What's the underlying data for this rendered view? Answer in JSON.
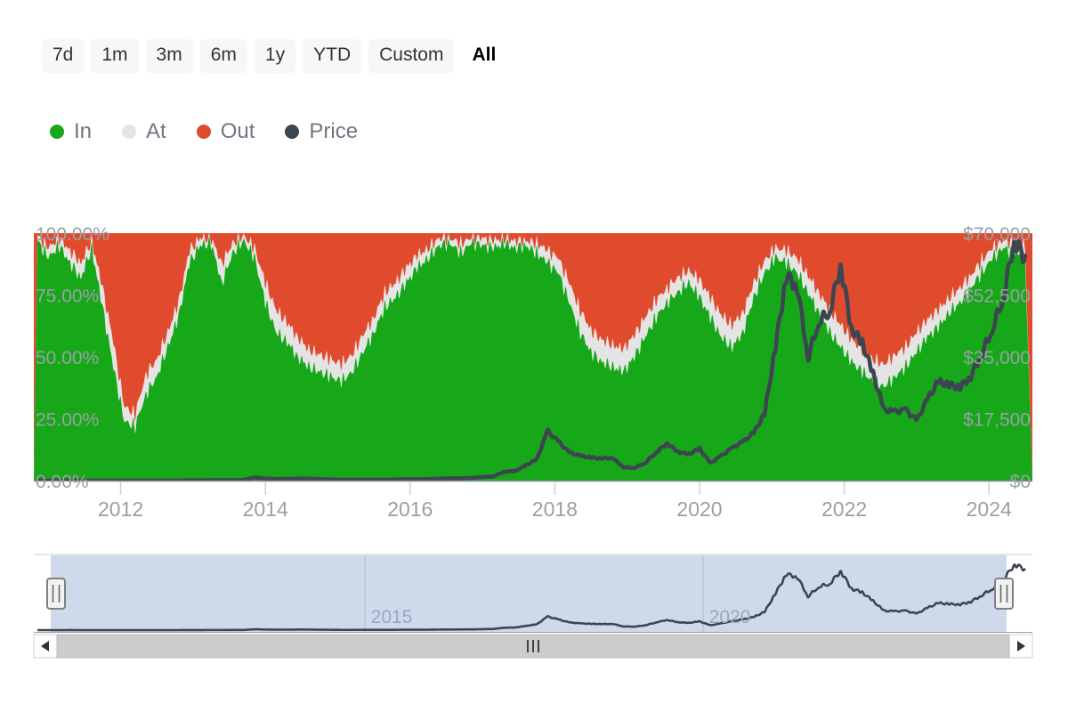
{
  "range_selector": {
    "buttons": [
      {
        "label": "7d",
        "selected": false
      },
      {
        "label": "1m",
        "selected": false
      },
      {
        "label": "3m",
        "selected": false
      },
      {
        "label": "6m",
        "selected": false
      },
      {
        "label": "1y",
        "selected": false
      },
      {
        "label": "YTD",
        "selected": false
      },
      {
        "label": "Custom",
        "selected": false
      },
      {
        "label": "All",
        "selected": true
      }
    ]
  },
  "legend": {
    "items": [
      {
        "label": "In",
        "color": "#17a81a"
      },
      {
        "label": "At",
        "color": "#e4e4e4"
      },
      {
        "label": "Out",
        "color": "#e04b2e"
      },
      {
        "label": "Price",
        "color": "#3d4550"
      }
    ]
  },
  "chart_data": {
    "type": "area",
    "title": "",
    "subtitle": "",
    "xlabel": "",
    "ylabel": "",
    "y2label": "",
    "grid": false,
    "legend_position": "top-left",
    "x_ticks": [
      "2012",
      "2014",
      "2016",
      "2018",
      "2020",
      "2022",
      "2024"
    ],
    "x_tick_values": [
      2012,
      2014,
      2016,
      2018,
      2020,
      2022,
      2024
    ],
    "xlim": [
      2010.8,
      2024.6
    ],
    "y_left_ticks": [
      "0.00%",
      "25.00%",
      "50.00%",
      "75.00%",
      "100.00%"
    ],
    "y_left_values": [
      0,
      25,
      50,
      75,
      100
    ],
    "ylim": [
      0,
      100
    ],
    "y_right_ticks": [
      "$0",
      "$17,500",
      "$35,000",
      "$52,500",
      "$70,000"
    ],
    "y_right_values": [
      0,
      17500,
      35000,
      52500,
      70000
    ],
    "y2lim": [
      0,
      70000
    ],
    "x": [
      2010.85,
      2011.0,
      2011.15,
      2011.3,
      2011.45,
      2011.6,
      2011.75,
      2011.9,
      2012.05,
      2012.2,
      2012.35,
      2012.5,
      2012.65,
      2012.8,
      2012.95,
      2013.1,
      2013.25,
      2013.4,
      2013.55,
      2013.7,
      2013.85,
      2014.0,
      2014.15,
      2014.3,
      2014.45,
      2014.6,
      2014.75,
      2014.9,
      2015.05,
      2015.2,
      2015.35,
      2015.5,
      2015.65,
      2015.8,
      2015.95,
      2016.1,
      2016.25,
      2016.4,
      2016.55,
      2016.7,
      2016.85,
      2017.0,
      2017.15,
      2017.3,
      2017.45,
      2017.6,
      2017.75,
      2017.9,
      2018.05,
      2018.2,
      2018.35,
      2018.5,
      2018.65,
      2018.8,
      2018.95,
      2019.1,
      2019.25,
      2019.4,
      2019.55,
      2019.7,
      2019.85,
      2020.0,
      2020.15,
      2020.3,
      2020.45,
      2020.6,
      2020.75,
      2020.9,
      2021.05,
      2021.2,
      2021.35,
      2021.5,
      2021.65,
      2021.8,
      2021.95,
      2022.1,
      2022.25,
      2022.4,
      2022.55,
      2022.7,
      2022.85,
      2023.0,
      2023.15,
      2023.3,
      2023.45,
      2023.6,
      2023.75,
      2023.9,
      2024.05,
      2024.2,
      2024.35,
      2024.5
    ],
    "series": [
      {
        "name": "In",
        "color": "#17a81a",
        "stack": "percent",
        "values": [
          97,
          90,
          95,
          88,
          82,
          94,
          70,
          46,
          24,
          22,
          35,
          42,
          54,
          66,
          88,
          95,
          96,
          80,
          92,
          97,
          90,
          72,
          60,
          56,
          50,
          46,
          44,
          42,
          40,
          44,
          52,
          60,
          70,
          74,
          80,
          86,
          90,
          95,
          96,
          92,
          96,
          95,
          94,
          96,
          94,
          95,
          92,
          88,
          84,
          72,
          60,
          52,
          48,
          46,
          44,
          50,
          58,
          66,
          72,
          76,
          80,
          74,
          66,
          58,
          54,
          60,
          74,
          84,
          90,
          88,
          84,
          76,
          68,
          60,
          54,
          48,
          44,
          40,
          38,
          42,
          46,
          52,
          58,
          62,
          68,
          72,
          78,
          84,
          90,
          94,
          92,
          90
        ]
      },
      {
        "name": "At",
        "color": "#e4e4e4",
        "stack": "percent",
        "values": [
          2,
          4,
          3,
          5,
          6,
          3,
          8,
          10,
          6,
          5,
          8,
          7,
          6,
          6,
          5,
          3,
          2,
          8,
          4,
          2,
          4,
          8,
          9,
          8,
          8,
          7,
          7,
          7,
          7,
          7,
          7,
          6,
          6,
          6,
          6,
          5,
          4,
          3,
          2,
          4,
          2,
          3,
          3,
          2,
          3,
          2,
          4,
          5,
          6,
          8,
          9,
          9,
          9,
          9,
          9,
          9,
          8,
          7,
          6,
          6,
          5,
          7,
          8,
          9,
          9,
          8,
          6,
          5,
          4,
          5,
          6,
          7,
          8,
          9,
          9,
          9,
          9,
          9,
          9,
          9,
          8,
          8,
          7,
          7,
          6,
          6,
          5,
          5,
          4,
          3,
          4,
          5
        ]
      },
      {
        "name": "Out",
        "color": "#e04b2e",
        "stack": "percent",
        "values": [
          1,
          6,
          2,
          7,
          12,
          3,
          22,
          44,
          70,
          73,
          57,
          51,
          40,
          28,
          7,
          2,
          2,
          12,
          4,
          1,
          6,
          20,
          31,
          36,
          42,
          47,
          49,
          51,
          53,
          49,
          41,
          34,
          24,
          20,
          14,
          9,
          6,
          2,
          2,
          4,
          2,
          2,
          3,
          2,
          3,
          3,
          4,
          7,
          10,
          20,
          31,
          39,
          43,
          45,
          47,
          41,
          34,
          27,
          22,
          18,
          15,
          19,
          26,
          33,
          37,
          32,
          20,
          11,
          6,
          7,
          10,
          17,
          24,
          31,
          37,
          43,
          47,
          51,
          53,
          49,
          46,
          40,
          35,
          31,
          26,
          22,
          17,
          11,
          6,
          3,
          4,
          5
        ]
      },
      {
        "name": "Price",
        "color": "#3d4550",
        "axis": "right",
        "unit": "USD",
        "values": [
          0.3,
          1,
          10,
          17,
          4,
          3,
          3,
          5,
          6,
          8,
          12,
          12,
          13,
          13,
          100,
          95,
          120,
          110,
          130,
          200,
          900,
          600,
          450,
          480,
          600,
          580,
          380,
          350,
          230,
          240,
          240,
          265,
          240,
          320,
          430,
          420,
          440,
          600,
          650,
          700,
          760,
          1000,
          1200,
          2500,
          2700,
          4300,
          6000,
          14000,
          11000,
          8000,
          7000,
          6500,
          6300,
          6400,
          3800,
          3600,
          5000,
          8000,
          10500,
          8200,
          7500,
          9000,
          5000,
          7000,
          9200,
          11000,
          13500,
          19000,
          38000,
          58000,
          55000,
          35000,
          45000,
          48000,
          61000,
          43000,
          39000,
          30000,
          20000,
          19500,
          20000,
          17000,
          23000,
          28000,
          27000,
          26500,
          29500,
          36000,
          43000,
          52000,
          68000,
          63000,
          66000
        ]
      }
    ],
    "navigator": {
      "selected_range_full": true,
      "x_ticks": [
        "2015",
        "2020"
      ],
      "series_name": "Price"
    }
  }
}
